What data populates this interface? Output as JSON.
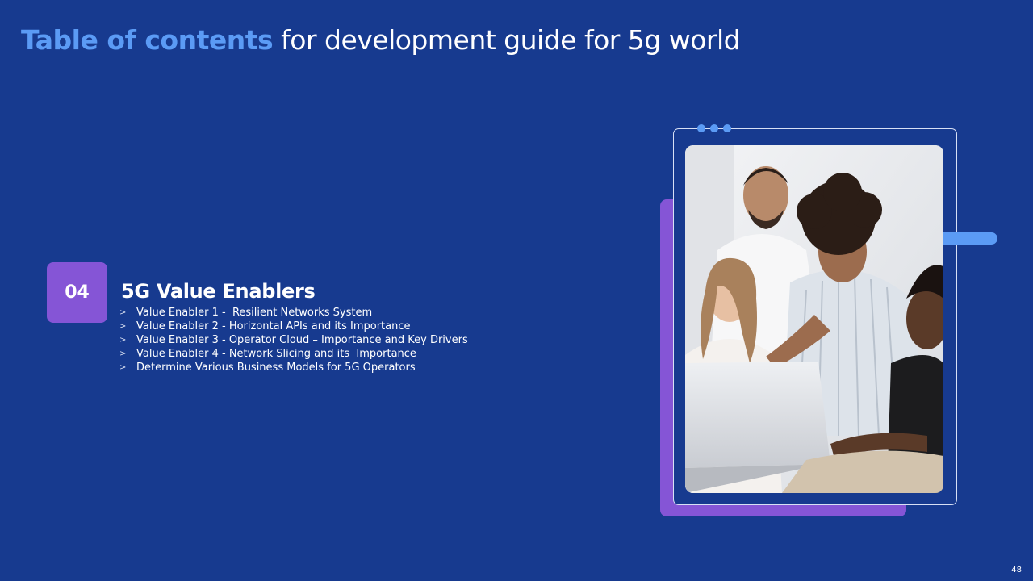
{
  "header": {
    "title_highlight": "Table of contents",
    "title_rest": " for development guide for 5g world"
  },
  "section": {
    "number": "04",
    "title": "5G Value Enablers",
    "bullet_icon": "chevron-right-icon",
    "items": [
      "Value Enabler 1 -  Resilient Networks System",
      "Value Enabler 2 - Horizontal APIs and its Importance",
      "Value Enabler 3 - Operator Cloud – Importance and Key Drivers",
      "Value Enabler 4 - Network Slicing and its  Importance",
      "Determine Various Business Models for 5G Operators"
    ]
  },
  "image": {
    "description_icon": "team-at-laptop-photo"
  },
  "footer": {
    "page_number": "48"
  },
  "colors": {
    "background": "#173a8f",
    "accent_blue": "#5b9bf5",
    "accent_purple": "#8555d6",
    "text": "#ffffff"
  }
}
